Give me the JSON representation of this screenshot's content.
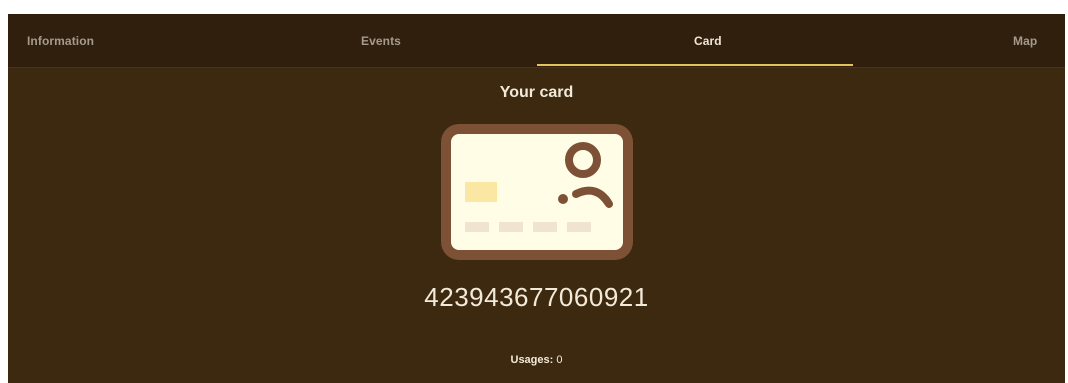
{
  "tabs": [
    {
      "label": "Information",
      "active": false
    },
    {
      "label": "Events",
      "active": false
    },
    {
      "label": "Card",
      "active": true
    },
    {
      "label": "Map",
      "active": false
    }
  ],
  "main": {
    "title": "Your card",
    "card_icon": "id-card-icon",
    "card_number": "423943677060921",
    "usages_label": "Usages:",
    "usages_value": "0"
  },
  "colors": {
    "background": "#3d2810",
    "tabbar": "#301f0d",
    "accent": "#e7c25b",
    "card_border": "#7d5135",
    "card_fill": "#fffde6"
  }
}
